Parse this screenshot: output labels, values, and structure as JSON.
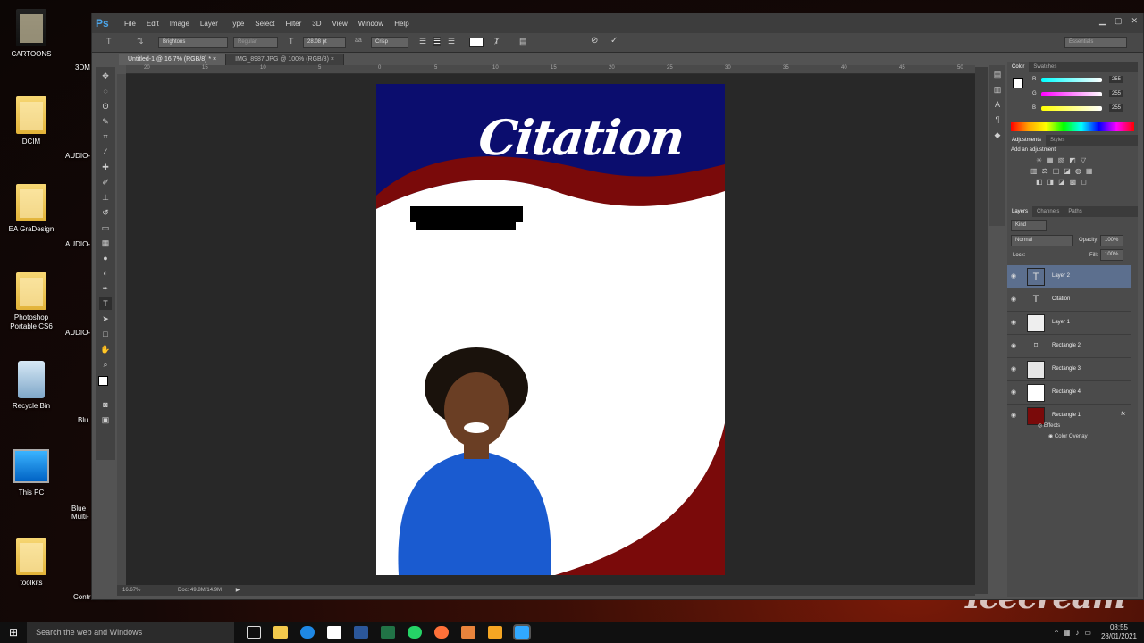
{
  "desktop_icons": [
    {
      "label": "CARTOONS",
      "row": 0
    },
    {
      "label": "DCIM",
      "row": 1
    },
    {
      "label": "EA GraDesign",
      "row": 2
    },
    {
      "label": "Photoshop Portable CS6",
      "row": 3
    },
    {
      "label": "Recycle Bin",
      "row": 4
    },
    {
      "label": "This PC",
      "row": 5
    },
    {
      "label": "toolkits",
      "row": 6
    }
  ],
  "desktop_icons_col2": [
    "3DM",
    "AUDIO-",
    "AUDIO-",
    "AUDIO-",
    "Blu",
    "Blue Multi-",
    "Control Panel"
  ],
  "app": {
    "logo": "Ps",
    "menus": [
      "File",
      "Edit",
      "Image",
      "Layer",
      "Type",
      "Select",
      "Filter",
      "3D",
      "View",
      "Window",
      "Help"
    ]
  },
  "options": {
    "font_family": "Brightons",
    "font_style": "Regular",
    "font_size": "28.08 pt",
    "aa": "Crisp",
    "workspace": "Essentials"
  },
  "tabs": [
    "Untitled-1 @ 16.7% (RGB/8) *",
    "IMG_8987.JPG @ 100% (RGB/8)"
  ],
  "ruler_labels": [
    "20",
    "15",
    "10",
    "5",
    "0",
    "5",
    "10",
    "15",
    "20",
    "25",
    "30",
    "35",
    "40",
    "45",
    "50"
  ],
  "canvas": {
    "title_text": "Citation"
  },
  "status": {
    "zoom": "16.67%",
    "doc": "Doc: 49.8M/14.9M"
  },
  "color_panel": {
    "tabs": [
      "Color",
      "Swatches"
    ],
    "channels": [
      {
        "name": "R",
        "value": "255"
      },
      {
        "name": "G",
        "value": "255"
      },
      {
        "name": "B",
        "value": "255"
      }
    ]
  },
  "adjustments": {
    "tabs": [
      "Adjustments",
      "Styles"
    ],
    "heading": "Add an adjustment"
  },
  "layers_panel": {
    "tabs": [
      "Layers",
      "Channels",
      "Paths"
    ],
    "filter": "Kind",
    "blend_mode": "Normal",
    "opacity_label": "Opacity:",
    "opacity": "100%",
    "lock_label": "Lock:",
    "fill_label": "Fill:",
    "fill": "100%",
    "layers": [
      {
        "name": "Layer 2",
        "thumb": "T",
        "selected": true
      },
      {
        "name": "Citation",
        "thumb": "T",
        "selected": false
      },
      {
        "name": "Layer 1",
        "thumb": "img",
        "selected": false
      },
      {
        "name": "Rectangle 2",
        "thumb": "shape",
        "selected": false
      },
      {
        "name": "Rectangle 3",
        "thumb": "img",
        "selected": false
      },
      {
        "name": "Rectangle 4",
        "thumb": "white",
        "selected": false
      },
      {
        "name": "Rectangle 1",
        "thumb": "red",
        "selected": false
      }
    ],
    "effects_label": "Effects",
    "effect_item": "Color Overlay",
    "fx": "fx"
  },
  "taskbar": {
    "search_placeholder": "Search the web and Windows",
    "time": "08:55",
    "date": "28/01/2021"
  },
  "watermark": "Icecream"
}
